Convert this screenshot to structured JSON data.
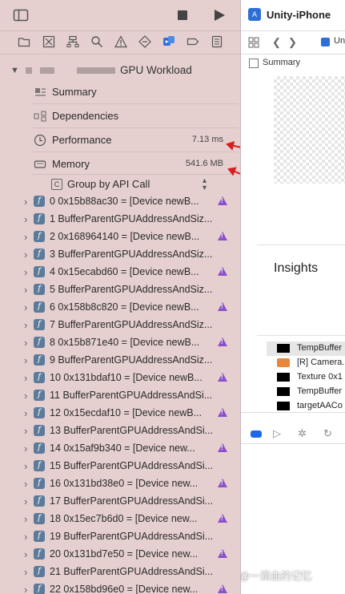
{
  "navigator": {
    "root_title": "GPU Workload",
    "items": [
      {
        "label": "Summary",
        "value": ""
      },
      {
        "label": "Dependencies",
        "value": ""
      },
      {
        "label": "Performance",
        "value": "7.13 ms"
      },
      {
        "label": "Memory",
        "value": "541.6 MB"
      }
    ],
    "group_by": "Group by API Call",
    "commands": [
      {
        "text": "0 0x15b88ac30 = [Device newB...",
        "warn": true
      },
      {
        "text": "1 BufferParentGPUAddressAndSiz...",
        "warn": false
      },
      {
        "text": "2 0x168964140 = [Device newB...",
        "warn": true
      },
      {
        "text": "3 BufferParentGPUAddressAndSiz...",
        "warn": false
      },
      {
        "text": "4 0x15ecabd60 = [Device newB...",
        "warn": true
      },
      {
        "text": "5 BufferParentGPUAddressAndSiz...",
        "warn": false
      },
      {
        "text": "6 0x158b8c820 = [Device newB...",
        "warn": true
      },
      {
        "text": "7 BufferParentGPUAddressAndSiz...",
        "warn": false
      },
      {
        "text": "8 0x15b871e40 = [Device newB...",
        "warn": true
      },
      {
        "text": "9 BufferParentGPUAddressAndSiz...",
        "warn": false
      },
      {
        "text": "10 0x131bdaf10 = [Device newB...",
        "warn": true
      },
      {
        "text": "11 BufferParentGPUAddressAndSi...",
        "warn": false
      },
      {
        "text": "12 0x15ecdaf10 = [Device newB...",
        "warn": true
      },
      {
        "text": "13 BufferParentGPUAddressAndSi...",
        "warn": false
      },
      {
        "text": "14 0x15af9b340 = [Device new...",
        "warn": true
      },
      {
        "text": "15 BufferParentGPUAddressAndSi...",
        "warn": false
      },
      {
        "text": "16 0x131bd38e0 = [Device new...",
        "warn": true
      },
      {
        "text": "17 BufferParentGPUAddressAndSi...",
        "warn": false
      },
      {
        "text": "18 0x15ec7b6d0 = [Device new...",
        "warn": true
      },
      {
        "text": "19 BufferParentGPUAddressAndSi...",
        "warn": false
      },
      {
        "text": "20 0x131bd7e50 = [Device new...",
        "warn": true
      },
      {
        "text": "21 BufferParentGPUAddressAndSi...",
        "warn": false
      },
      {
        "text": "22 0x158bd96e0 = [Device new...",
        "warn": true
      }
    ]
  },
  "editor": {
    "scheme_title": "Unity-iPhone",
    "crumb_partial": "Uni",
    "breadcrumb": "Summary",
    "insights_title": "Insights",
    "resources": [
      {
        "label": "TempBuffer",
        "kind": "thumb"
      },
      {
        "label": "[R] Camera.",
        "kind": "image"
      },
      {
        "label": "Texture 0x1",
        "kind": "thumb"
      },
      {
        "label": "TempBuffer",
        "kind": "thumb"
      },
      {
        "label": "targetAACo",
        "kind": "thumb"
      }
    ]
  },
  "watermark": "知乎 @一滴血的记忆",
  "colors": {
    "sidebar_bg": "#e5cfcf",
    "warning": "#8a4fc9",
    "annotation_arrow": "#d62020",
    "accent": "#1e68e8"
  }
}
